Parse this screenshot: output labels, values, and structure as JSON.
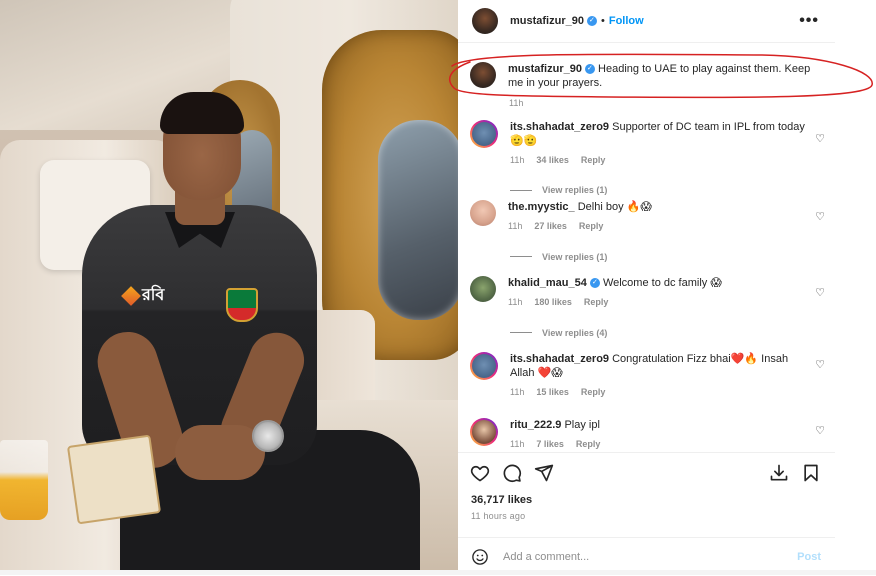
{
  "post": {
    "author": "mustafizur_90",
    "separator": "•",
    "follow_label": "Follow",
    "more_label": "•••",
    "caption": "Heading to UAE to play against them. Keep me in your prayers.",
    "caption_time": "11h"
  },
  "photo": {
    "sponsor_text": "রবি"
  },
  "comments": [
    {
      "username": "its.shahadat_zero9",
      "text": "Supporter of DC team in IPL from today🫡🫡",
      "time": "11h",
      "likes": "34 likes",
      "reply": "Reply",
      "view_replies": "View replies (1)"
    },
    {
      "username": "the.myystic_",
      "text": "Delhi boy 🔥😱",
      "time": "11h",
      "likes": "27 likes",
      "reply": "Reply",
      "view_replies": "View replies (1)"
    },
    {
      "username": "khalid_mau_54",
      "text": "Welcome to dc family 😱",
      "time": "11h",
      "likes": "180 likes",
      "reply": "Reply",
      "view_replies": "View replies (4)"
    },
    {
      "username": "its.shahadat_zero9",
      "text": "Congratulation Fizz bhai❤️🔥 Insah Allah ❤️😱",
      "time": "11h",
      "likes": "15 likes",
      "reply": "Reply",
      "view_replies": ""
    },
    {
      "username": "ritu_222.9",
      "text": "Play ipl",
      "time": "11h",
      "likes": "7 likes",
      "reply": "Reply",
      "view_replies": ""
    }
  ],
  "footer": {
    "likes": "36,717 likes",
    "time": "11 hours ago",
    "comment_placeholder": "Add a comment...",
    "post_label": "Post"
  },
  "colors": {
    "accent": "#0095f6",
    "verified": "#3897f0",
    "annotation": "#d62222"
  },
  "icons": {
    "actions": [
      "heart-icon",
      "comment-icon",
      "share-icon"
    ],
    "right_actions": [
      "download-icon",
      "bookmark-icon"
    ],
    "emoji": "emoji-icon"
  }
}
